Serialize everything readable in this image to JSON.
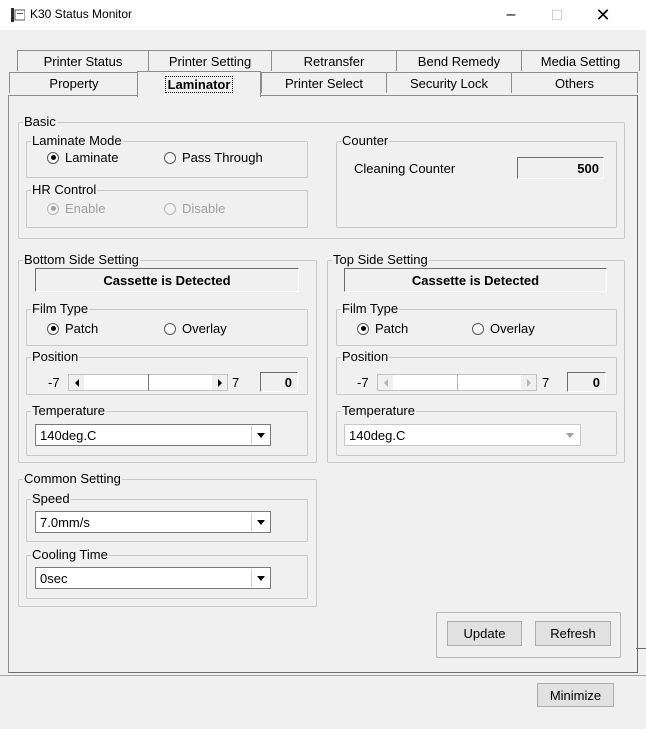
{
  "window": {
    "title": "K30 Status Monitor",
    "icon": "printer-app-icon"
  },
  "tabs_row1": [
    "Printer Status",
    "Printer Setting",
    "Retransfer",
    "Bend Remedy",
    "Media Setting"
  ],
  "tabs_row2": [
    "Property",
    "Laminator",
    "Printer Select",
    "Security Lock",
    "Others"
  ],
  "active_tab": "Laminator",
  "basic": {
    "legend": "Basic",
    "laminate_mode": {
      "legend": "Laminate Mode",
      "opt1": "Laminate",
      "opt2": "Pass Through",
      "selected": "Laminate"
    },
    "hr_control": {
      "legend": "HR Control",
      "opt1": "Enable",
      "opt2": "Disable",
      "selected": "Enable",
      "disabled": true
    },
    "counter": {
      "legend": "Counter",
      "label": "Cleaning Counter",
      "value": "500"
    }
  },
  "bottom": {
    "legend": "Bottom Side Setting",
    "status": "Cassette is Detected",
    "film_type": {
      "legend": "Film Type",
      "opt1": "Patch",
      "opt2": "Overlay",
      "selected": "Patch"
    },
    "position": {
      "legend": "Position",
      "min": "-7",
      "max": "7",
      "value": "0"
    },
    "temperature": {
      "legend": "Temperature",
      "value": "140deg.C"
    }
  },
  "top": {
    "legend": "Top Side Setting",
    "status": "Cassette is Detected",
    "film_type": {
      "legend": "Film Type",
      "opt1": "Patch",
      "opt2": "Overlay",
      "selected": "Patch"
    },
    "position": {
      "legend": "Position",
      "min": "-7",
      "max": "7",
      "value": "0"
    },
    "temperature": {
      "legend": "Temperature",
      "value": "140deg.C"
    }
  },
  "common": {
    "legend": "Common Setting",
    "speed": {
      "legend": "Speed",
      "value": "7.0mm/s"
    },
    "cooling": {
      "legend": "Cooling Time",
      "value": "0sec"
    }
  },
  "buttons": {
    "update": "Update",
    "refresh": "Refresh",
    "minimize": "Minimize"
  }
}
